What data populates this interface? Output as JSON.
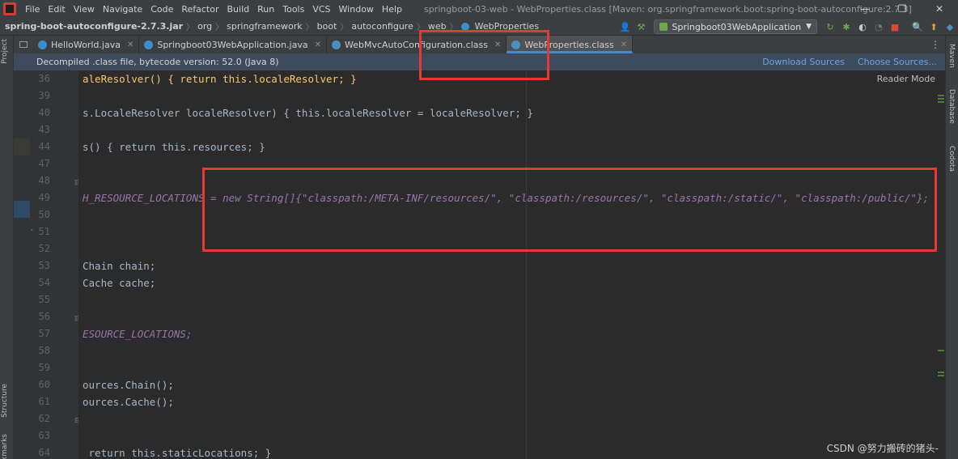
{
  "menu": [
    "File",
    "Edit",
    "View",
    "Navigate",
    "Code",
    "Refactor",
    "Build",
    "Run",
    "Tools",
    "VCS",
    "Window",
    "Help"
  ],
  "window_title": "springboot-03-web - WebProperties.class [Maven: org.springframework.boot:spring-boot-autoconfigure:2.7.3]",
  "breadcrumb": [
    "spring-boot-autoconfigure-2.7.3.jar",
    "org",
    "springframework",
    "boot",
    "autoconfigure",
    "web",
    "WebProperties"
  ],
  "run_config": "Springboot03WebApplication",
  "tabs": [
    {
      "label": "HelloWorld.java",
      "active": false
    },
    {
      "label": "Springboot03WebApplication.java",
      "active": false
    },
    {
      "label": "WebMvcAutoConfiguration.class",
      "active": false
    },
    {
      "label": "WebProperties.class",
      "active": true
    }
  ],
  "banner": {
    "text": "Decompiled .class file, bytecode version: 52.0 (Java 8)",
    "download_sources": "Download Sources",
    "choose_sources": "Choose Sources..."
  },
  "reader_mode": "Reader Mode",
  "side_labels": {
    "project": "Project",
    "structure": "Structure",
    "bookmarks": "Bookmarks",
    "maven": "Maven",
    "database": "Database",
    "codota": "Codota"
  },
  "line_numbers": [
    "36",
    "39",
    "40",
    "43",
    "44",
    "47",
    "48",
    "49",
    "50",
    "51",
    "52",
    "53",
    "54",
    "55",
    "56",
    "57",
    "58",
    "59",
    "60",
    "61",
    "62",
    "63",
    "64"
  ],
  "code_lines": {
    "l36": "aleResolver() { return this.localeResolver; }",
    "l40": "s.LocaleResolver localeResolver) { this.localeResolver = localeResolver; }",
    "l44": "s() { return this.resources; }",
    "l49": "H_RESOURCE_LOCATIONS = new String[]{\"classpath:/META-INF/resources/\", \"classpath:/resources/\", \"classpath:/static/\", \"classpath:/public/\"};",
    "l53": "Chain chain;",
    "l54": "Cache cache;",
    "l57": "ESOURCE_LOCATIONS;",
    "l60": "ources.Chain();",
    "l61": "ources.Cache();",
    "l64": " return this.staticLocations; }"
  },
  "watermark": "CSDN @努力搬砖的猪头-",
  "colors": {
    "highlight": "#e53935",
    "keyword": "#cc7832",
    "string": "#6a8759",
    "field": "#9876aa"
  }
}
